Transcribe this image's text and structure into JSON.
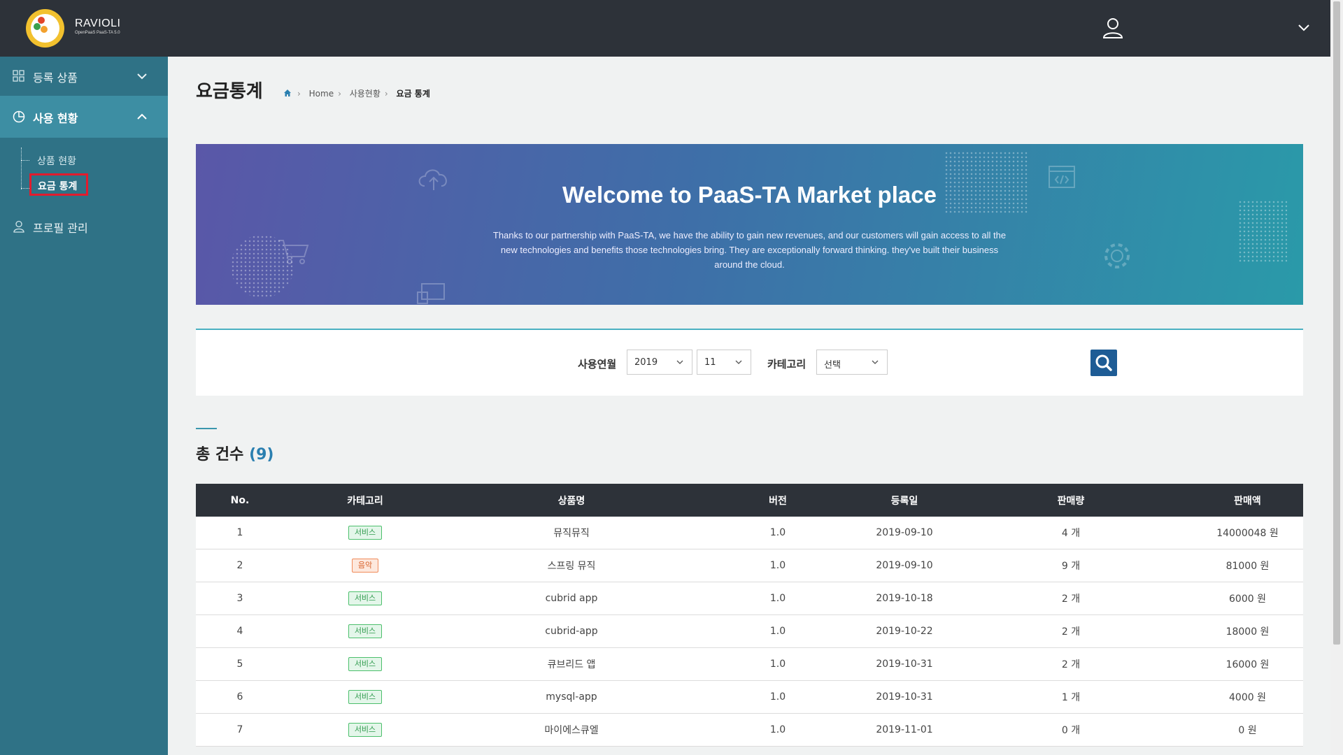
{
  "brand": {
    "name": "RAVIOLI",
    "sub": "OpenPaaS PaaS-TA 5.0"
  },
  "sidebar": {
    "items": [
      {
        "label": "등록 상품",
        "icon": "grid-icon"
      },
      {
        "label": "사용 현황",
        "icon": "pie-chart-icon"
      },
      {
        "label": "프로필 관리",
        "icon": "user-icon"
      }
    ],
    "sub_items": [
      {
        "label": "상품 현황"
      },
      {
        "label": "요금 통계"
      }
    ]
  },
  "page": {
    "title": "요금통계"
  },
  "breadcrumb": {
    "home": "Home",
    "mid": "사용현황",
    "current": "요금 통계"
  },
  "banner": {
    "title": "Welcome to PaaS-TA Market place",
    "body": "Thanks to our partnership with PaaS-TA, we have the ability to gain new revenues, and our customers will gain access to all the new technologies and benefits those technologies bring. They are exceptionally forward thinking. they've built their business around the cloud."
  },
  "search": {
    "period_label": "사용연월",
    "year": "2019",
    "month": "11",
    "category_label": "카테고리",
    "category": "선택"
  },
  "count": {
    "label": "총 건수",
    "value": "(9)"
  },
  "table": {
    "headers": [
      "No.",
      "카테고리",
      "상품명",
      "버전",
      "등록일",
      "판매량",
      "판매액"
    ],
    "rows": [
      {
        "no": "1",
        "category": "서비스",
        "type": "svc",
        "name": "뮤직뮤직",
        "version": "1.0",
        "date": "2019-09-10",
        "qty": "4 개",
        "amount": "14000048 원"
      },
      {
        "no": "2",
        "category": "음악",
        "type": "mus",
        "name": "스프링 뮤직",
        "version": "1.0",
        "date": "2019-09-10",
        "qty": "9 개",
        "amount": "81000 원"
      },
      {
        "no": "3",
        "category": "서비스",
        "type": "svc",
        "name": "cubrid app",
        "version": "1.0",
        "date": "2019-10-18",
        "qty": "2 개",
        "amount": "6000 원"
      },
      {
        "no": "4",
        "category": "서비스",
        "type": "svc",
        "name": "cubrid-app",
        "version": "1.0",
        "date": "2019-10-22",
        "qty": "2 개",
        "amount": "18000 원"
      },
      {
        "no": "5",
        "category": "서비스",
        "type": "svc",
        "name": "큐브리드 앱",
        "version": "1.0",
        "date": "2019-10-31",
        "qty": "2 개",
        "amount": "16000 원"
      },
      {
        "no": "6",
        "category": "서비스",
        "type": "svc",
        "name": "mysql-app",
        "version": "1.0",
        "date": "2019-10-31",
        "qty": "1 개",
        "amount": "4000 원"
      },
      {
        "no": "7",
        "category": "서비스",
        "type": "svc",
        "name": "마이에스큐엘",
        "version": "1.0",
        "date": "2019-11-01",
        "qty": "0 개",
        "amount": "0 원"
      }
    ]
  }
}
